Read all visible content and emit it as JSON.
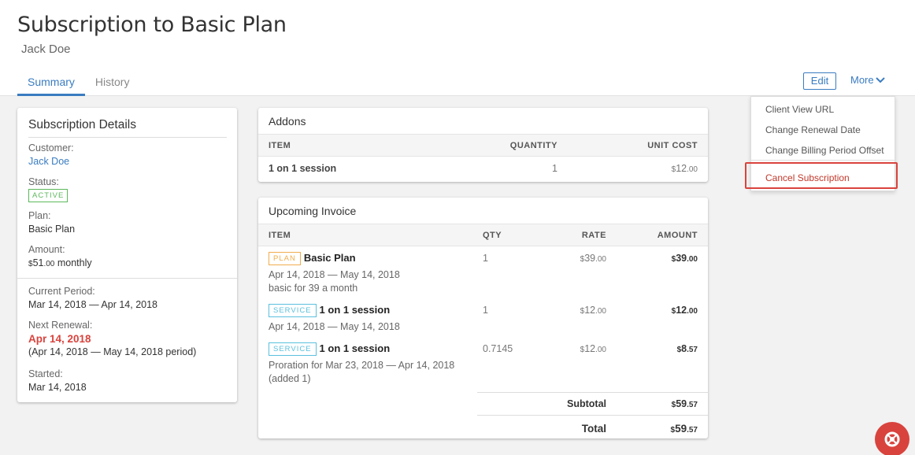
{
  "header": {
    "title": "Subscription to Basic Plan",
    "subtitle": "Jack Doe",
    "tabs": [
      {
        "label": "Summary"
      },
      {
        "label": "History"
      }
    ],
    "edit_label": "Edit",
    "more_label": "More"
  },
  "details": {
    "title": "Subscription Details",
    "customer_label": "Customer:",
    "customer_value": "Jack Doe",
    "status_label": "Status:",
    "status_value": "ACTIVE",
    "plan_label": "Plan:",
    "plan_value": "Basic Plan",
    "amount_label": "Amount:",
    "amount_currency": "$",
    "amount_whole": "51",
    "amount_cents": ".00",
    "amount_suffix": "monthly",
    "current_period_label": "Current Period:",
    "current_period_value": "Mar 14, 2018 — Apr 14, 2018",
    "next_renewal_label": "Next Renewal:",
    "next_renewal_value": "Apr 14, 2018",
    "next_renewal_period": "(Apr 14, 2018 — May 14, 2018 period)",
    "started_label": "Started:",
    "started_value": "Mar 14, 2018"
  },
  "addons": {
    "title": "Addons",
    "columns": [
      "ITEM",
      "QUANTITY",
      "UNIT COST"
    ],
    "rows": [
      {
        "item": "1 on 1 session",
        "quantity": "1",
        "cost_currency": "$",
        "cost_whole": "12",
        "cost_cents": ".00"
      }
    ]
  },
  "invoice": {
    "title": "Upcoming Invoice",
    "columns": [
      "ITEM",
      "QTY",
      "RATE",
      "AMOUNT"
    ],
    "rows": [
      {
        "tag": "PLAN",
        "name": "Basic Plan",
        "sub1": "Apr 14, 2018 — May 14, 2018",
        "sub2": "basic for 39 a month",
        "qty": "1",
        "rate_currency": "$",
        "rate_whole": "39",
        "rate_cents": ".00",
        "amount_currency": "$",
        "amount_whole": "39",
        "amount_cents": ".00"
      },
      {
        "tag": "SERVICE",
        "name": "1 on 1 session",
        "sub1": "Apr 14, 2018 — May 14, 2018",
        "qty": "1",
        "rate_currency": "$",
        "rate_whole": "12",
        "rate_cents": ".00",
        "amount_currency": "$",
        "amount_whole": "12",
        "amount_cents": ".00"
      },
      {
        "tag": "SERVICE",
        "name": "1 on 1 session",
        "sub1": "Proration for Mar 23, 2018 — Apr 14, 2018",
        "sub2": "(added 1)",
        "qty": "0.7145",
        "rate_currency": "$",
        "rate_whole": "12",
        "rate_cents": ".00",
        "amount_currency": "$",
        "amount_whole": "8",
        "amount_cents": ".57"
      }
    ],
    "subtotal_label": "Subtotal",
    "subtotal_currency": "$",
    "subtotal_whole": "59",
    "subtotal_cents": ".57",
    "total_label": "Total",
    "total_currency": "$",
    "total_whole": "59",
    "total_cents": ".57"
  },
  "dropdown": {
    "items": [
      "Client View URL",
      "Change Renewal Date",
      "Change Billing Period Offset"
    ],
    "cancel": "Cancel Subscription"
  },
  "colors": {
    "accent": "#3a7cc1",
    "danger": "#d9433d",
    "active": "#5cb85c",
    "plan": "#f0ad4e",
    "service": "#5bc0de"
  }
}
